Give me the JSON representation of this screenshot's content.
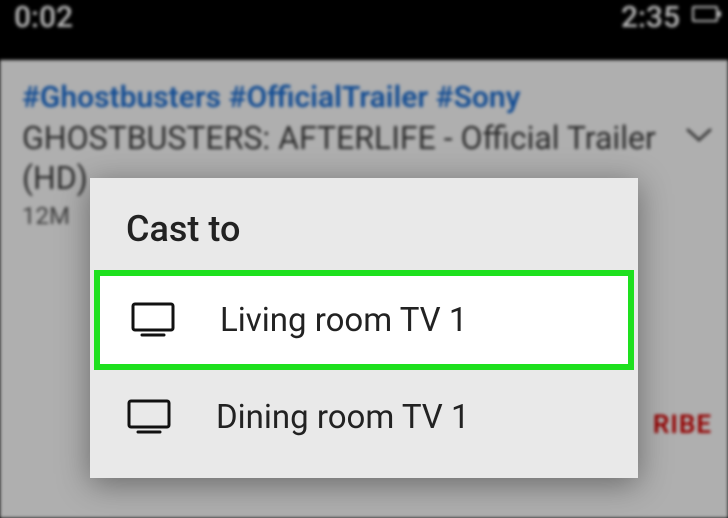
{
  "status_bar": {
    "time": "0:02",
    "remaining": "2:35"
  },
  "video": {
    "hashtags": "#Ghostbusters #OfficialTrailer #Sony",
    "title": "GHOSTBUSTERS: AFTERLIFE - Official Trailer (HD)",
    "views_fragment": "12M",
    "subscribe_fragment": "RIBE"
  },
  "cast_dialog": {
    "title": "Cast to",
    "devices": [
      {
        "label": "Living room TV 1",
        "highlighted": true
      },
      {
        "label": "Dining room TV 1",
        "highlighted": false
      }
    ]
  },
  "icons": {
    "chevron_down": "chevron-down-icon",
    "tv": "tv-icon",
    "battery": "battery-icon"
  }
}
